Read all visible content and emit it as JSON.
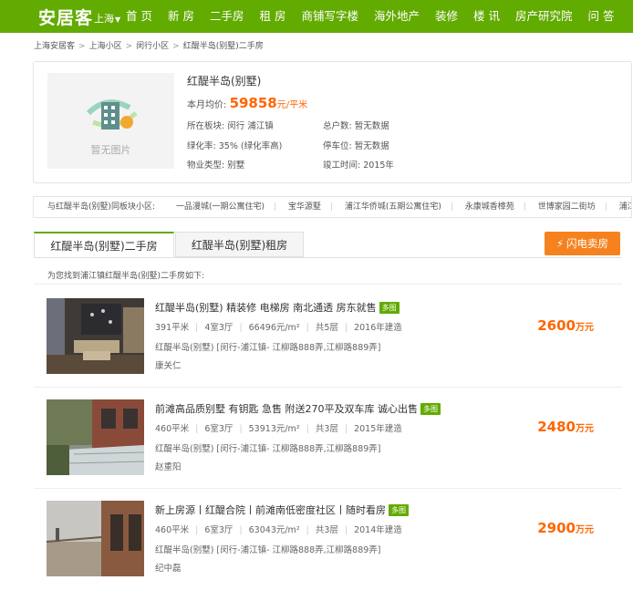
{
  "nav": {
    "logo": "安居客",
    "city": "上海",
    "items": [
      "首 页",
      "新 房",
      "二手房",
      "租 房",
      "商铺写字楼",
      "海外地产",
      "装修",
      "楼 讯",
      "房产研究院",
      "问 答"
    ]
  },
  "breadcrumb": [
    "上海安居客",
    "上海小区",
    "闵行小区",
    "红醍半岛(别墅)二手房"
  ],
  "community": {
    "no_photo": "暂无图片",
    "name": "红醍半岛(别墅)",
    "price_label": "本月均价:",
    "price": "59858",
    "price_unit": "元/平米",
    "attrs": {
      "block_label": "所在板块:",
      "block_value": "闵行 浦江镇",
      "households_label": "总户数:",
      "households_value": "暂无数据",
      "green_label": "绿化率:",
      "green_value": "35% (绿化率高)",
      "parking_label": "停车位:",
      "parking_value": "暂无数据",
      "property_label": "物业类型:",
      "property_value": "别墅",
      "completed_label": "竣工时间:",
      "completed_value": "2015年"
    }
  },
  "same_block": {
    "label": "与红醍半岛(别墅)同板块小区:",
    "items": [
      "一品漫城(一期公寓住宅)",
      "宝华源墅",
      "浦江华侨城(五期公寓住宅)",
      "永康城香樟苑",
      "世博家园二街坊",
      "浦江瑞和城"
    ]
  },
  "tabs": {
    "active": "红醍半岛(别墅)二手房",
    "other": "红醍半岛(别墅)租房",
    "flash_button": "闪电卖房"
  },
  "found_text": "为您找到浦江镇红醍半岛(别墅)二手房如下:",
  "listings": [
    {
      "title": "红醍半岛(别墅) 精装修 电梯房 南北通透 房东就售",
      "tag": "多图",
      "area": "391平米",
      "layout": "4室3厅",
      "unit_price": "66496元/m²",
      "floor": "共5层",
      "year": "2016年建造",
      "address": "红醍半岛(别墅) [闵行-浦江镇- 江柳路888弄,江柳路889弄]",
      "agent": "康关仁",
      "price": "2600",
      "price_unit": "万元"
    },
    {
      "title": "前滩高品质别墅 有钥匙 急售 附送270平及双车库 诚心出售",
      "tag": "多图",
      "area": "460平米",
      "layout": "6室3厅",
      "unit_price": "53913元/m²",
      "floor": "共3层",
      "year": "2015年建造",
      "address": "红醍半岛(别墅) [闵行-浦江镇- 江柳路888弄,江柳路889弄]",
      "agent": "赵重阳",
      "price": "2480",
      "price_unit": "万元"
    },
    {
      "title": "新上房源丨红醍合院丨前滩南低密度社区丨随时看房",
      "tag": "多图",
      "area": "460平米",
      "layout": "6室3厅",
      "unit_price": "63043元/m²",
      "floor": "共3层",
      "year": "2014年建造",
      "address": "红醍半岛(别墅) [闵行-浦江镇- 江柳路888弄,江柳路889弄]",
      "agent": "纪中磊",
      "price": "2900",
      "price_unit": "万元"
    }
  ],
  "colors": {
    "brand": "#62ab00",
    "price": "#ff6600",
    "flash": "#f5821f"
  }
}
